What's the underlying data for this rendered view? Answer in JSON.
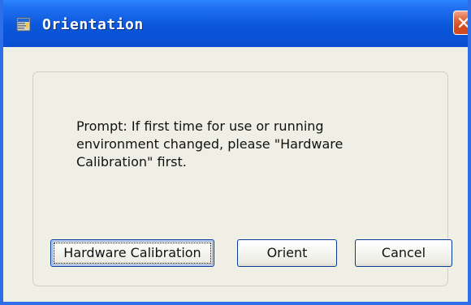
{
  "window": {
    "title": "Orientation",
    "app_icon": "toolbar-window-icon",
    "close_icon": "close-icon",
    "accent_color": "#0b57da",
    "close_color": "#d4471e"
  },
  "content": {
    "prompt": "Prompt: If first time for use or running environment changed, please \"Hardware Calibration\" first."
  },
  "buttons": {
    "hardware_calibration": "Hardware Calibration",
    "orient": "Orient",
    "cancel": "Cancel"
  }
}
